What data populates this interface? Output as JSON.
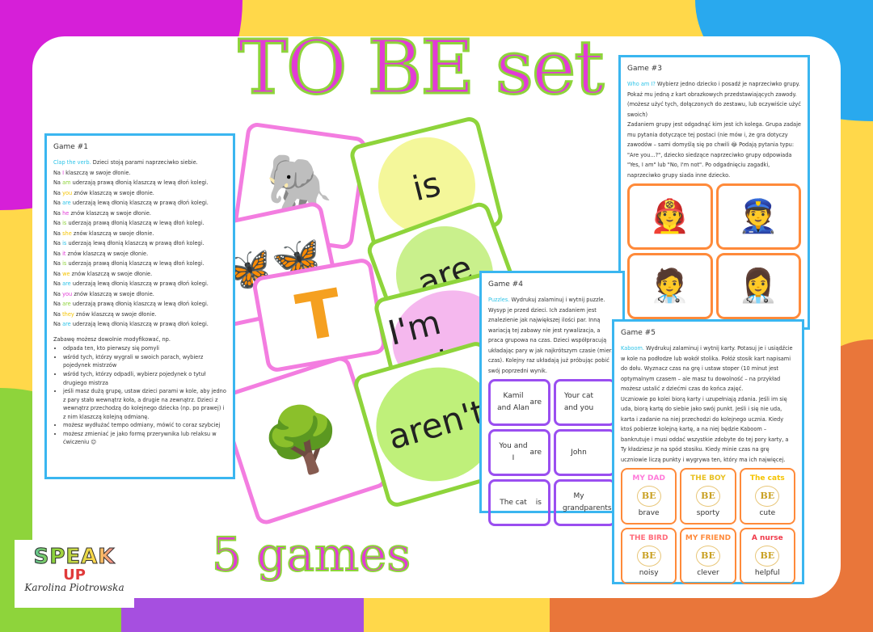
{
  "title": "TO BE set",
  "subtitle": "5 games",
  "colors": {
    "title_fill": "#e23ad6",
    "title_outline": "#8ed43b",
    "doc_border": "#3ab6f0",
    "puzzle_border": "#9a4ef0",
    "card_border": "#ff8a3a"
  },
  "logo": {
    "line1": "SPEAK",
    "line2": "UP",
    "author": "Karolina Piotrowska"
  },
  "game1": {
    "heading": "Game #1",
    "intro_hl": "Clap the verb.",
    "intro": "Dzieci stoją parami naprzeciwko siebie.",
    "lines": [
      [
        "I",
        "klaszczą w swoje dłonie."
      ],
      [
        "am",
        "uderzają prawą dłonią klaszczą w lewą dłoń kolegi."
      ],
      [
        "you",
        "znów klaszczą w swoje dłonie."
      ],
      [
        "are",
        "uderzają lewą dłonią klaszczą w prawą dłoń kolegi."
      ],
      [
        "he",
        "znów klaszczą w swoje dłonie."
      ],
      [
        "is",
        "uderzają prawą dłonią klaszczą w lewą dłoń kolegi."
      ],
      [
        "she",
        "znów klaszczą w swoje dłonie."
      ],
      [
        "is",
        "uderzają lewą dłonią klaszczą w prawą dłoń kolegi."
      ],
      [
        "it",
        "znów klaszczą w swoje dłonie."
      ],
      [
        "is",
        "uderzają prawą dłonią klaszczą w lewą dłoń kolegi."
      ],
      [
        "we",
        "znów klaszczą w swoje dłonie."
      ],
      [
        "are",
        "uderzają lewą dłonią klaszczą w prawą dłoń kolegi."
      ],
      [
        "you",
        "znów klaszczą w swoje dłonie."
      ],
      [
        "are",
        "uderzają prawą dłonią klaszczą w lewą dłoń kolegi."
      ],
      [
        "they",
        "znów klaszczą w swoje dłonie."
      ],
      [
        "are",
        "uderzają lewą dłonią klaszczą w prawą dłoń kolegi."
      ]
    ],
    "mod": "Zabawę możesz dowolnie modyfikować, np.",
    "bullets": [
      "odpada ten, kto pierwszy się pomyli",
      "wśród tych, którzy wygrali w swoich parach, wybierz pojedynek mistrzów",
      "wśród tych, którzy odpadli, wybierz pojedynek o tytuł drugiego mistrza",
      "jeśli masz dużą grupę, ustaw dzieci parami w kole, aby jedno z pary stało wewnątrz koła, a drugie na zewnątrz. Dzieci z wewnątrz przechodzą do kolejnego dziecka (np. po prawej) i z nim klaszczą kolejną odmianę.",
      "możesz wydłużać tempo odmiany, mówić to coraz szybciej",
      "możesz zmieniać je jako formę przerywnika lub relaksu w ćwiczeniu 😊"
    ]
  },
  "word_cards": [
    "is",
    "are",
    "I'm not",
    "aren't"
  ],
  "game3": {
    "heading": "Game #3",
    "intro_hl": "Who am I?",
    "text": "Wybierz jedno dziecko i posadź je naprzeciwko grupy. Pokaż mu jedną z kart obrazkowych przedstawiających zawody. (możesz użyć tych, dołączonych do zestawu, lub oczywiście użyć swoich)",
    "text2": "Zadaniem grupy jest odgadnąć kim jest ich kolega. Grupa zadaje mu pytania dotyczące tej postaci (nie mów i, że gra dotyczy zawodów – sami domyślą się po chwili 😂 Podają pytania typu: \"Are you...?\", dziecko siedzące naprzeciwko grupy odpowiada \"Yes, I am\" lub \"No, I'm not\". Po odgadnięciu zagadki, naprzeciwko grupy siada inne dziecko."
  },
  "game4": {
    "heading": "Game #4",
    "intro_hl": "Puzzles.",
    "text": "Wydrukuj zalaminuj i wytnij puzzle. Wysyp je przed dzieci. Ich zadaniem jest znalezienie jak największej ilości par. Inną wariacją tej zabawy nie jest rywalizacja, a praca grupowa na czas. Dzieci współpracują układając pary w jak najkrótszym czasie (mierz czas). Kolejny raz układają już próbując pobić swój poprzedni wynik.",
    "puzzles": [
      [
        "Kamil and Alan",
        "are"
      ],
      [
        "Your cat and you",
        ""
      ],
      [
        "You and I",
        "are"
      ],
      [
        "John",
        ""
      ],
      [
        "The cat",
        "is"
      ],
      [
        "My grandparents",
        ""
      ]
    ]
  },
  "game5": {
    "heading": "Game #5",
    "intro_hl": "Kaboom.",
    "text": "Wydrukuj zalaminuj i wytnij karty. Potasuj je i usiądźcie w kole na podłodze lub wokół stolika. Połóż stosik kart napisami do dołu. Wyznacz czas na grę i ustaw stoper (10 minut jest optymalnym czasem – ale masz tu dowolność – na przykład możesz ustalić z dziećmi czas do końca zajęć.",
    "text2": "Uczniowie po kolei biorą karty i uzupełniają zdania. Jeśli im się uda, biorą kartę do siebie jako swój punkt. Jeśli i się nie uda, karta i zadanie na niej przechodzi do kolejnego ucznia. Kiedy ktoś pobierze kolejną kartę, a na niej będzie Kaboom – bankrutuje i musi oddać wszystkie zdobyte do tej pory karty, a Ty kładziesz je na spód stosiku. Kiedy minie czas na grę uczniowie liczą punkty i wygrywa ten, który ma ich najwięcej.",
    "cards": [
      {
        "subject": "MY DAD",
        "verb": "BE",
        "adj": "brave",
        "color": "#ff7ad9"
      },
      {
        "subject": "THE BOY",
        "verb": "BE",
        "adj": "sporty",
        "color": "#e8c020"
      },
      {
        "subject": "The cats",
        "verb": "BE",
        "adj": "cute",
        "color": "#f5c400"
      },
      {
        "subject": "THE BIRD",
        "verb": "BE",
        "adj": "noisy",
        "color": "#ff6b7a"
      },
      {
        "subject": "MY FRIEND",
        "verb": "BE",
        "adj": "clever",
        "color": "#ff8a3a"
      },
      {
        "subject": "A nurse",
        "verb": "BE",
        "adj": "helpful",
        "color": "#f03a4a"
      }
    ]
  }
}
